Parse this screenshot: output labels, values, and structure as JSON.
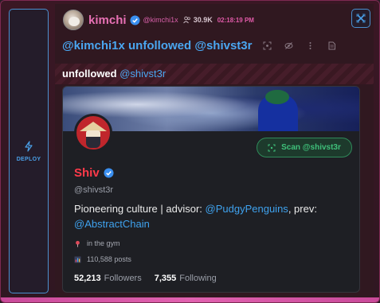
{
  "colors": {
    "accent_pink": "#e871b5",
    "accent_blue": "#4aa6f0",
    "name_red": "#ff3a4a",
    "scan_green": "#3fc07a"
  },
  "deploy": {
    "label": "DEPLOY",
    "icon": "lightning-icon"
  },
  "header": {
    "username": "kimchi",
    "handle": "@kimchi1x",
    "followers": "30.9K",
    "time": "02:18:19 PM"
  },
  "headline": "@kimchi1x unfollowed @shivst3r",
  "toolbar_icons": [
    "scan-icon",
    "hide-icon",
    "more-icon",
    "document-icon"
  ],
  "subline": {
    "prefix": "unfollowed",
    "mention": "@shivst3r"
  },
  "profile": {
    "name": "Shiv",
    "handle": "@shivst3r",
    "scan_label": "Scan @shivst3r",
    "bio_prefix": "Pioneering culture | advisor: ",
    "bio_link1": "@PudgyPenguins",
    "bio_mid": ", prev: ",
    "bio_link2": "@AbstractChain",
    "location": "in the gym",
    "posts": "110,588 posts",
    "followers_count": "52,213",
    "followers_label": "Followers",
    "following_count": "7,355",
    "following_label": "Following"
  }
}
